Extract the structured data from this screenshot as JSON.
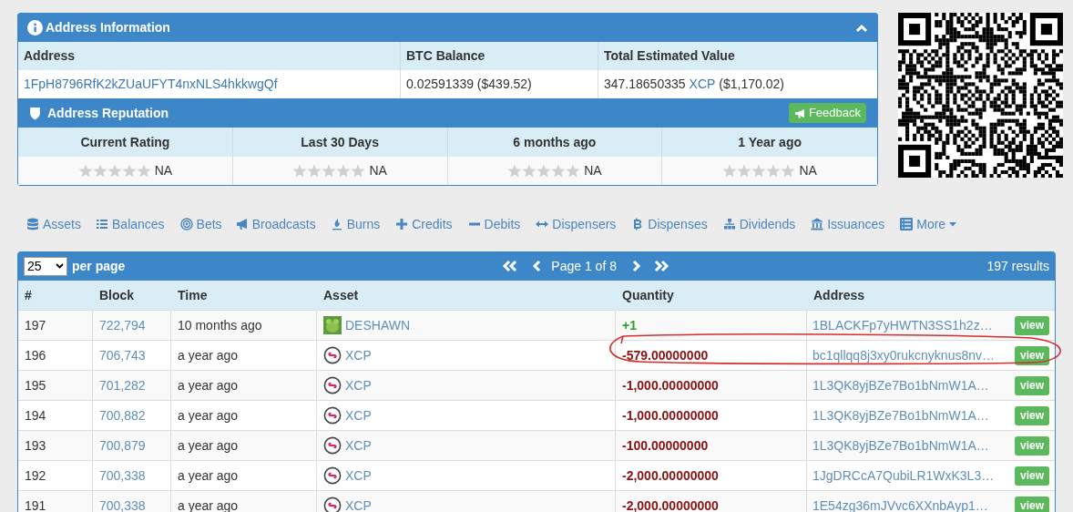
{
  "address_info": {
    "title": "Address Information",
    "columns": [
      "Address",
      "BTC Balance",
      "Total Estimated Value"
    ],
    "address": "1FpH8796RfK2kZUaUFYT4nxNLS4hkkwgQf",
    "btc_balance": "0.02591339 ($439.52)",
    "total_value_amount": "347.18650335",
    "total_value_asset": "XCP",
    "total_value_usd": "($1,170.02)"
  },
  "reputation": {
    "title": "Address Reputation",
    "feedback_button": "Feedback",
    "ratings": [
      {
        "label": "Current Rating",
        "stars": 0,
        "value": "NA"
      },
      {
        "label": "Last 30 Days",
        "stars": 0,
        "value": "NA"
      },
      {
        "label": "6 months ago",
        "stars": 0,
        "value": "NA"
      },
      {
        "label": "1 Year ago",
        "stars": 0,
        "value": "NA"
      }
    ]
  },
  "nav_tabs": [
    {
      "label": "Assets",
      "kind": "database"
    },
    {
      "label": "Balances",
      "kind": "list"
    },
    {
      "label": "Bets",
      "kind": "target"
    },
    {
      "label": "Broadcasts",
      "kind": "megaphone"
    },
    {
      "label": "Burns",
      "kind": "flame"
    },
    {
      "label": "Credits",
      "kind": "plus"
    },
    {
      "label": "Debits",
      "kind": "minus"
    },
    {
      "label": "Dispensers",
      "kind": "arrows"
    },
    {
      "label": "Dispenses",
      "kind": "bitcoin"
    },
    {
      "label": "Dividends",
      "kind": "sitemap"
    },
    {
      "label": "Issuances",
      "kind": "bank"
    },
    {
      "label": "More",
      "kind": "more"
    }
  ],
  "table": {
    "per_page": "25",
    "per_page_label": "per page",
    "page_label": "Page 1 of 8",
    "results": "197 results",
    "columns": [
      "#",
      "Block",
      "Time",
      "Asset",
      "Quantity",
      "Address"
    ],
    "rows": [
      {
        "index": "197",
        "block": "722,794",
        "time": "10 months ago",
        "asset": {
          "kind": "image",
          "name": "DESHAWN"
        },
        "quantity": {
          "kind": "credit",
          "value": "+1"
        },
        "address": "1BLACKFp7yHWTN3SS1h2z…",
        "action": "view"
      },
      {
        "index": "196",
        "block": "706,743",
        "time": "a year ago",
        "asset": {
          "kind": "xcp",
          "name": "XCP"
        },
        "quantity": {
          "kind": "debit",
          "value": "-579.00000000"
        },
        "address": "bc1qllqq8j3xy0rukcnyknus8nv…",
        "action": "view"
      },
      {
        "index": "195",
        "block": "701,282",
        "time": "a year ago",
        "asset": {
          "kind": "xcp",
          "name": "XCP"
        },
        "quantity": {
          "kind": "debit",
          "value": "-1,000.00000000"
        },
        "address": "1L3QK8yjBZe7Bo1bNmW1A…",
        "action": "view"
      },
      {
        "index": "194",
        "block": "700,882",
        "time": "a year ago",
        "asset": {
          "kind": "xcp",
          "name": "XCP"
        },
        "quantity": {
          "kind": "debit",
          "value": "-1,000.00000000"
        },
        "address": "1L3QK8yjBZe7Bo1bNmW1A…",
        "action": "view"
      },
      {
        "index": "193",
        "block": "700,879",
        "time": "a year ago",
        "asset": {
          "kind": "xcp",
          "name": "XCP"
        },
        "quantity": {
          "kind": "debit",
          "value": "-100.00000000"
        },
        "address": "1L3QK8yjBZe7Bo1bNmW1A…",
        "action": "view"
      },
      {
        "index": "192",
        "block": "700,338",
        "time": "a year ago",
        "asset": {
          "kind": "xcp",
          "name": "XCP"
        },
        "quantity": {
          "kind": "debit",
          "value": "-2,000.00000000"
        },
        "address": "1JgDRCcA7QubiLR1WxK3L3…",
        "action": "view"
      },
      {
        "index": "191",
        "block": "700,338",
        "time": "a year ago",
        "asset": {
          "kind": "xcp",
          "name": "XCP"
        },
        "quantity": {
          "kind": "debit",
          "value": "-2,000.00000000"
        },
        "address": "1E54zg36mJVvc6XXnbAyp1…",
        "action": "view"
      }
    ]
  }
}
